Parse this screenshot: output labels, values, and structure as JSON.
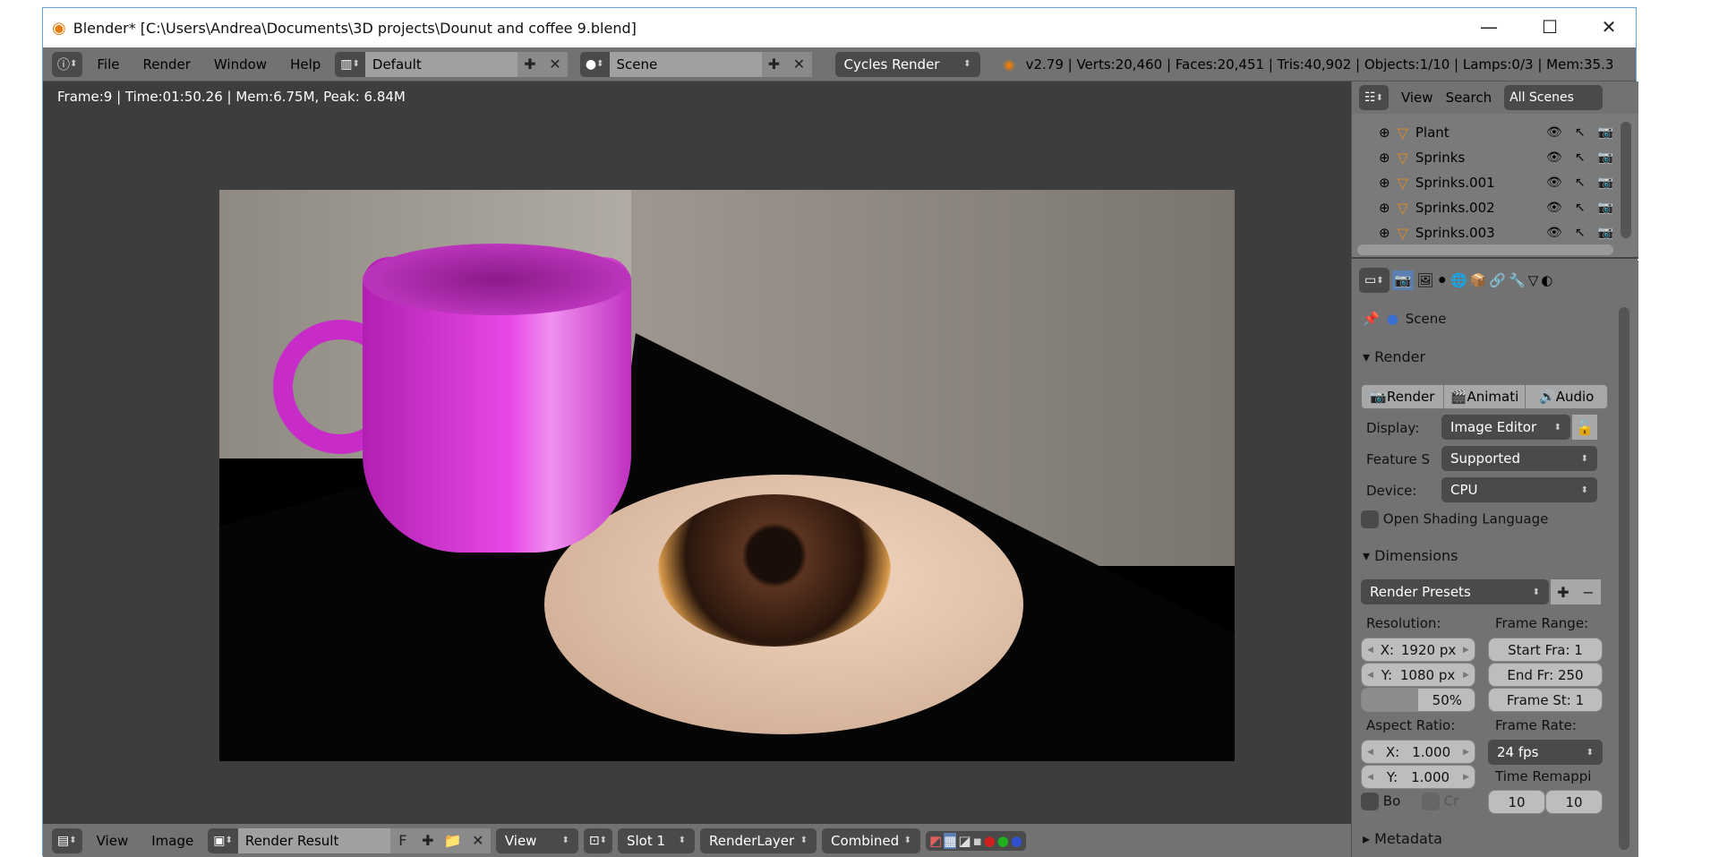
{
  "window": {
    "title": "Blender* [C:\\Users\\Andrea\\Documents\\3D projects\\Dounut and coffee 9.blend]",
    "minimize": "—",
    "maximize": "☐",
    "close": "✕"
  },
  "topbar": {
    "menus": [
      "File",
      "Render",
      "Window",
      "Help"
    ],
    "layout": "Default",
    "scene": "Scene",
    "engine": "Cycles Render",
    "stats": "v2.79 | Verts:20,460 | Faces:20,451 | Tris:40,902 | Objects:1/10 | Lamps:0/3 | Mem:35.3"
  },
  "viewport": {
    "stats": "Frame:9 | Time:01:50.26 | Mem:6.75M, Peak: 6.84M"
  },
  "outliner": {
    "view": "View",
    "search": "Search",
    "filter": "All Scenes",
    "items": [
      "Plant",
      "Sprinks",
      "Sprinks.001",
      "Sprinks.002",
      "Sprinks.003"
    ]
  },
  "properties": {
    "context": "Scene",
    "render": {
      "title": "Render",
      "buttons": [
        "Render",
        "Animati",
        "Audio"
      ],
      "display_label": "Display:",
      "display": "Image Editor",
      "feature_label": "Feature S",
      "feature": "Supported",
      "device_label": "Device:",
      "device": "CPU",
      "osl": "Open Shading Language"
    },
    "dimensions": {
      "title": "Dimensions",
      "presets": "Render Presets",
      "resolution_label": "Resolution:",
      "res_x": "X:",
      "res_x_val": "1920 px",
      "res_y": "Y:",
      "res_y_val": "1080 px",
      "res_pct": "50%",
      "res_pct_value": 50,
      "frame_range_label": "Frame Range:",
      "start": "Start Fra: 1",
      "end": "End Fr: 250",
      "step": "Frame St: 1",
      "aspect_label": "Aspect Ratio:",
      "asp_x": "X:",
      "asp_x_val": "1.000",
      "asp_y": "Y:",
      "asp_y_val": "1.000",
      "frame_rate_label": "Frame Rate:",
      "fps": "24 fps",
      "time_remap_label": "Time Remappi",
      "remap_old": "10",
      "remap_new": "10",
      "border": "Bo",
      "crop": "Cr"
    },
    "metadata": {
      "title": "Metadata"
    }
  },
  "bottombar": {
    "view": "View",
    "image": "Image",
    "image_name": "Render Result",
    "fake": "F",
    "view_mode": "View",
    "slot": "Slot 1",
    "layer": "RenderLayer",
    "pass": "Combined"
  },
  "colors": {
    "header": "#727272",
    "viewport": "#3d3d3d",
    "mug": "#e040e0",
    "accent": "#e08a1e"
  }
}
